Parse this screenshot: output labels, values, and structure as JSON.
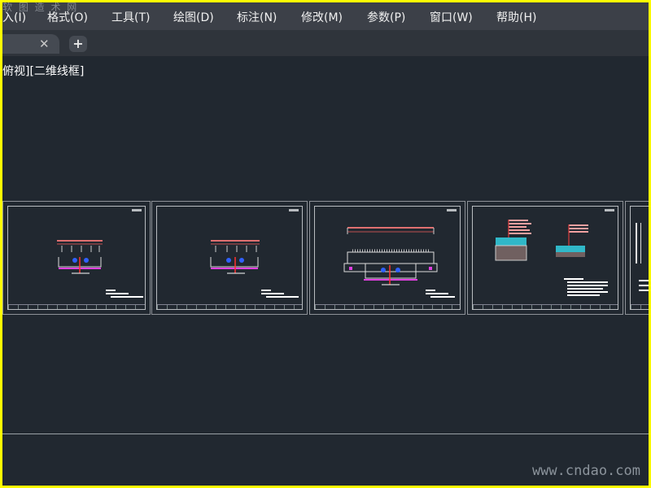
{
  "watermark_top": "软 图 造 术 网",
  "menu": {
    "items": [
      "入(I)",
      "格式(O)",
      "工具(T)",
      "绘图(D)",
      "标注(N)",
      "修改(M)",
      "参数(P)",
      "窗口(W)",
      "帮助(H)"
    ]
  },
  "tabs": {
    "close_icon": "✕",
    "new_tab": "+"
  },
  "viewport": {
    "label": "俯视][二维线框]"
  },
  "layouts": {
    "count": 5,
    "drawings": [
      "elevation-section",
      "elevation-section",
      "foundation-section",
      "detail-sections",
      "partial-sheet"
    ]
  },
  "colors": {
    "background": "#212830",
    "menubar": "#3c4048",
    "frame": "#ffff00"
  },
  "watermark_bottom": "www.cndao.com"
}
